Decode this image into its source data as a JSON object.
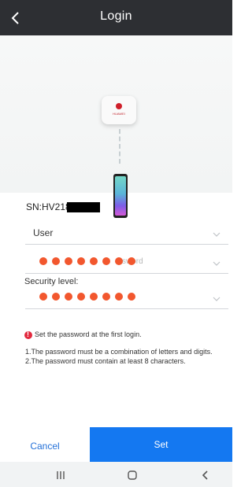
{
  "header": {
    "title": "Login"
  },
  "device": {
    "logo_text": "HUAWEI"
  },
  "sn": {
    "label": "SN:HV218"
  },
  "form": {
    "user_value": "User",
    "password_placeholder": "ssword",
    "security_label": "Security level:"
  },
  "notice": {
    "text": "Set the password at the first login."
  },
  "rules": {
    "line1": "1.The password must be a combination of letters and digits.",
    "line2": "2.The password must contain at least 8 characters."
  },
  "actions": {
    "cancel": "Cancel",
    "set": "Set"
  },
  "colors": {
    "header_bg": "#2d2f33",
    "primary": "#1478f1",
    "cancel_text": "#2370d8",
    "redaction": "#f2572e",
    "notice_icon": "#e2293e"
  },
  "icons": {
    "back": "chevron-left-icon",
    "caret": "chevron-down-icon",
    "notice": "warning-icon",
    "system_recent": "recent-apps-icon",
    "system_home": "home-icon",
    "system_back": "back-icon"
  }
}
